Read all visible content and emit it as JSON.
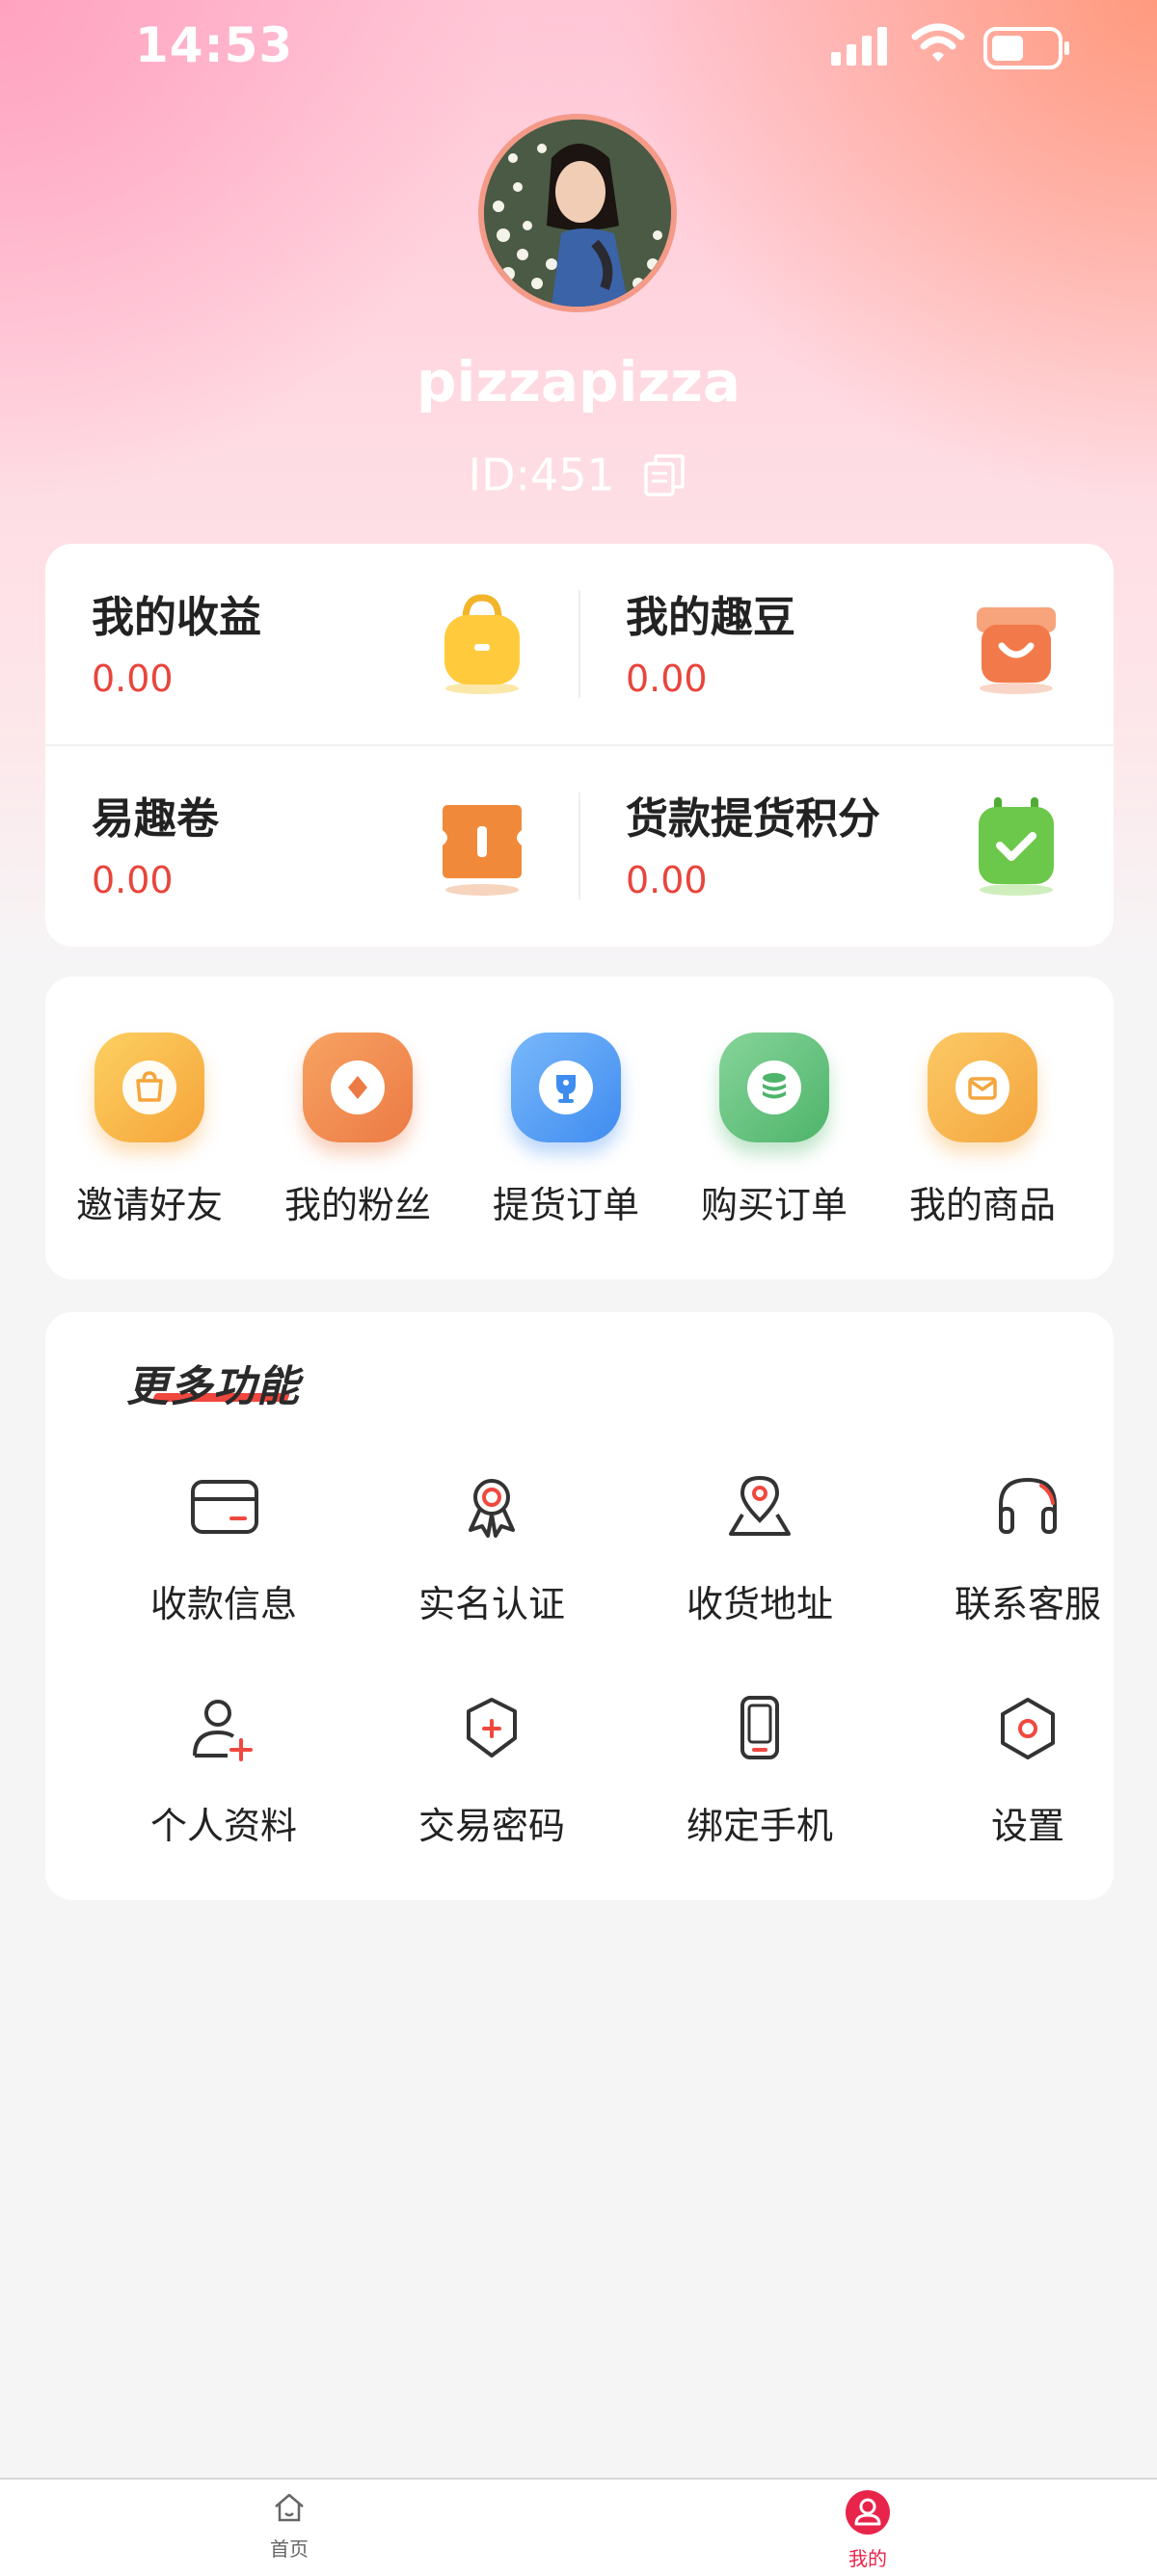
{
  "status_bar": {
    "time": "14:53"
  },
  "profile": {
    "username": "pizzapizza",
    "user_id": "ID:451"
  },
  "stats": [
    {
      "label": "我的收益",
      "value": "0.00",
      "icon": "wallet-bag-icon",
      "color": "#ffcb3d"
    },
    {
      "label": "我的趣豆",
      "value": "0.00",
      "icon": "gift-box-icon",
      "color": "#f27a4a"
    },
    {
      "label": "易趣卷",
      "value": "0.00",
      "icon": "coupon-icon",
      "color": "#f08a3a"
    },
    {
      "label": "货款提货积分",
      "value": "0.00",
      "icon": "calendar-check-icon",
      "color": "#6cc84a"
    }
  ],
  "shortcuts": [
    {
      "label": "邀请好友",
      "icon": "shopping-bag-icon",
      "color": "#f9b43f"
    },
    {
      "label": "我的粉丝",
      "icon": "coin-icon",
      "color": "#f08a4a"
    },
    {
      "label": "提货订单",
      "icon": "trophy-icon",
      "color": "#4f9df5"
    },
    {
      "label": "购买订单",
      "icon": "database-icon",
      "color": "#62c47e"
    },
    {
      "label": "我的商品",
      "icon": "envelope-icon",
      "color": "#f8b647"
    }
  ],
  "more_functions": {
    "title": "更多功能",
    "items": [
      {
        "label": "收款信息",
        "icon": "card-icon"
      },
      {
        "label": "实名认证",
        "icon": "badge-icon"
      },
      {
        "label": "收货地址",
        "icon": "location-pin-icon"
      },
      {
        "label": "联系客服",
        "icon": "headset-icon"
      },
      {
        "label": "个人资料",
        "icon": "user-add-icon"
      },
      {
        "label": "交易密码",
        "icon": "shield-plus-icon"
      },
      {
        "label": "绑定手机",
        "icon": "phone-icon"
      },
      {
        "label": "设置",
        "icon": "settings-hexagon-icon"
      }
    ]
  },
  "tabbar": {
    "items": [
      {
        "label": "首页",
        "icon": "home-icon",
        "active": false
      },
      {
        "label": "我的",
        "icon": "profile-icon",
        "active": true
      }
    ],
    "active_color": "#e8244a"
  }
}
